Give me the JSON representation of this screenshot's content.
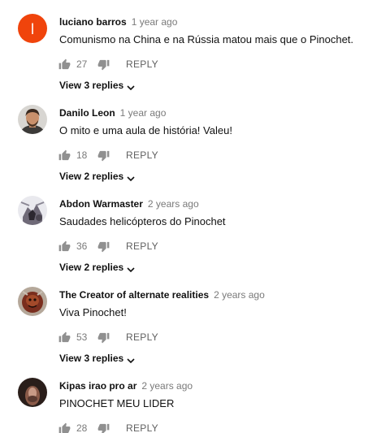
{
  "icons": {
    "like": "thumbs-up-icon",
    "dislike": "thumbs-down-icon",
    "expand": "chevron-down-icon"
  },
  "colors": {
    "avatar_letter_bg": "#f0440c",
    "meta_gray": "#7a7a7a",
    "text": "#111111"
  },
  "comments": [
    {
      "avatar_letter": "l",
      "author": "luciano barros",
      "time": "1 year ago",
      "text": "Comunismo na China e na Rússia matou mais que o Pinochet.",
      "likes": "27",
      "reply_label": "REPLY",
      "view_replies": "View 3 replies"
    },
    {
      "author": "Danilo Leon",
      "time": "1 year ago",
      "text": "O mito e uma aula de história! Valeu!",
      "likes": "18",
      "reply_label": "REPLY",
      "view_replies": "View 2 replies"
    },
    {
      "author": "Abdon Warmaster",
      "time": "2 years ago",
      "text": "Saudades helicópteros do Pinochet",
      "likes": "36",
      "reply_label": "REPLY",
      "view_replies": "View 2 replies"
    },
    {
      "author": "The Creator of alternate realities",
      "time": "2 years ago",
      "text": "Viva Pinochet!",
      "likes": "53",
      "reply_label": "REPLY",
      "view_replies": "View 3 replies"
    },
    {
      "author": "Kipas irao pro ar",
      "time": "2 years ago",
      "text": "PINOCHET MEU LIDER",
      "likes": "28",
      "reply_label": "REPLY"
    }
  ]
}
